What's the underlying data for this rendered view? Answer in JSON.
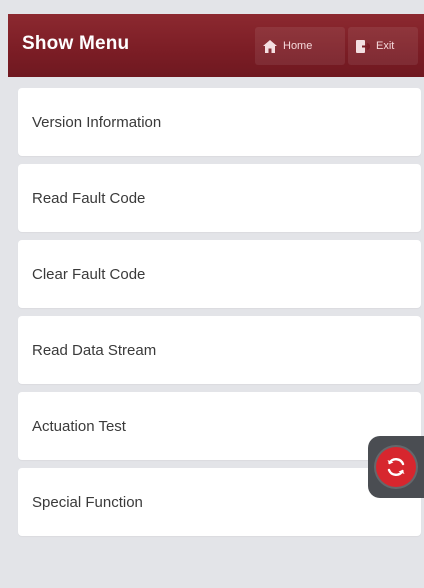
{
  "header": {
    "title": "Show Menu",
    "home_label": "Home",
    "exit_label": "Exit",
    "accent_color": "#7b1d25"
  },
  "menu": {
    "items": [
      {
        "label": "Version Information"
      },
      {
        "label": "Read Fault Code"
      },
      {
        "label": "Clear Fault Code"
      },
      {
        "label": "Read Data Stream"
      },
      {
        "label": "Actuation Test"
      },
      {
        "label": "Special Function"
      }
    ]
  },
  "floating_button": {
    "icon": "refresh-icon",
    "color": "#d7262e"
  }
}
